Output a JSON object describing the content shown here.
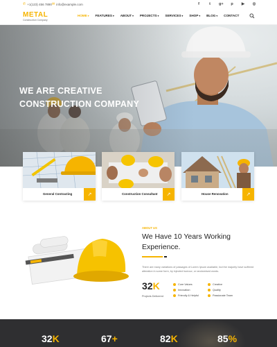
{
  "topbar": {
    "phone": "+1(123) 456 7890",
    "email": "info@example.com",
    "social_icons": [
      {
        "icon": "facebook-icon",
        "glyph": "f"
      },
      {
        "icon": "twitter-icon",
        "glyph": "t"
      },
      {
        "icon": "googleplus-icon",
        "glyph": "g+"
      },
      {
        "icon": "pinterest-icon",
        "glyph": "p"
      },
      {
        "icon": "youtube-icon",
        "glyph": "▶"
      },
      {
        "icon": "instagram-icon",
        "glyph": "◎"
      }
    ]
  },
  "header": {
    "logo": "METAL",
    "logo_sub": "Construction Company",
    "nav": [
      {
        "label": "HOME",
        "dropdown": true,
        "active": true
      },
      {
        "label": "FEATURES",
        "dropdown": true,
        "active": false
      },
      {
        "label": "ABOUT",
        "dropdown": true,
        "active": false
      },
      {
        "label": "PROJECTS",
        "dropdown": true,
        "active": false
      },
      {
        "label": "SERVICES",
        "dropdown": true,
        "active": false
      },
      {
        "label": "SHOP",
        "dropdown": true,
        "active": false
      },
      {
        "label": "BLOG",
        "dropdown": true,
        "active": false
      },
      {
        "label": "CONTACT",
        "dropdown": false,
        "active": false
      }
    ],
    "search_icon": "search-icon"
  },
  "hero": {
    "title_line1": "WE ARE CREATIVE",
    "title_line2": "CONSTRUCTION COMPANY"
  },
  "services": [
    {
      "label": "General Contracting",
      "image": "blueprint-hardhat-image"
    },
    {
      "label": "Construction Consultant",
      "image": "team-meeting-image"
    },
    {
      "label": "House Renovation",
      "image": "house-renovation-image"
    }
  ],
  "about": {
    "label": "ABOUT US",
    "heading_line1": "We Have 10 Years Working",
    "heading_line2": "Experience.",
    "text": "There are many variations of passages of Lorem Ipsum available, but the majority have suffered alteration in some form, by injected humour, or randomised words.",
    "stat_value": "32",
    "stat_suffix": "K",
    "stat_label": "Projects Delivered",
    "features_left": [
      "Core Values",
      "Innovation",
      "Friendly & Helpful"
    ],
    "features_right": [
      "Creative",
      "Quality",
      "Passionate Team"
    ]
  },
  "stats_band": [
    {
      "value": "32",
      "suffix": "K"
    },
    {
      "value": "67",
      "suffix": "+"
    },
    {
      "value": "82",
      "suffix": "K"
    },
    {
      "value": "85",
      "suffix": "%"
    }
  ],
  "colors": {
    "accent": "#f6b400",
    "dark": "#2f2f31",
    "text": "#222222"
  }
}
